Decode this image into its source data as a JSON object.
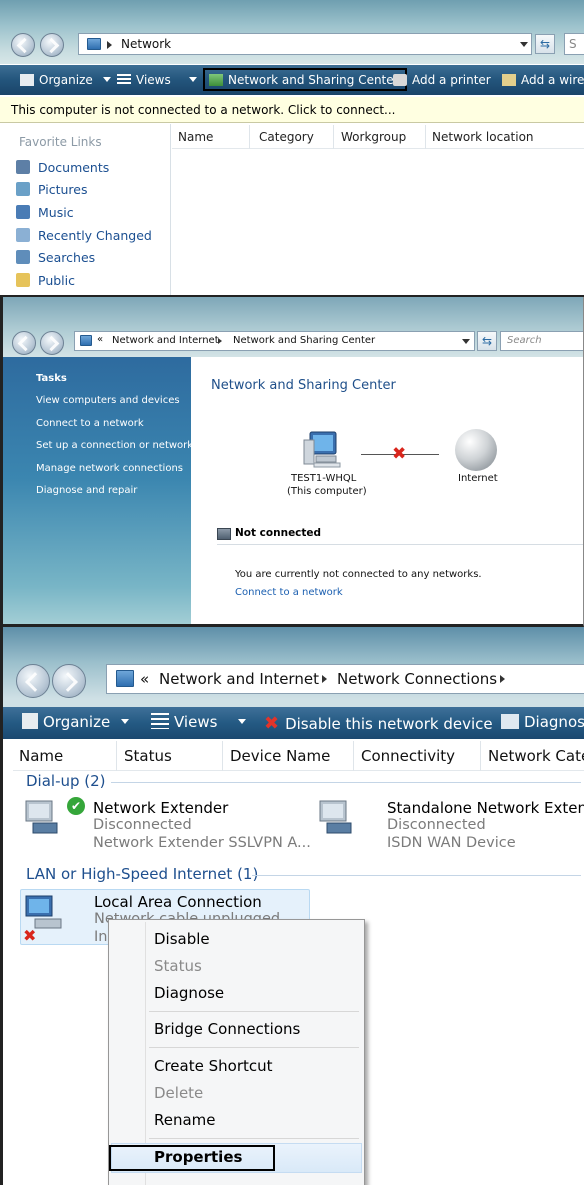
{
  "panel1": {
    "address": {
      "location": "Network",
      "search_hint": "S"
    },
    "toolbar": {
      "organize": "Organize",
      "views": "Views",
      "network_sharing_center": "Network and Sharing Center",
      "add_printer": "Add a printer",
      "add_wireless": "Add a wire"
    },
    "infobar": "This computer is not connected to a network. Click to connect...",
    "favorites": {
      "header": "Favorite Links",
      "items": [
        {
          "label": "Documents",
          "icon": "documents-icon"
        },
        {
          "label": "Pictures",
          "icon": "pictures-icon"
        },
        {
          "label": "Music",
          "icon": "music-icon"
        },
        {
          "label": "Recently Changed",
          "icon": "recent-icon"
        },
        {
          "label": "Searches",
          "icon": "searches-icon"
        },
        {
          "label": "Public",
          "icon": "public-folder-icon"
        }
      ]
    },
    "columns": [
      "Name",
      "Category",
      "Workgroup",
      "Network location"
    ]
  },
  "panel2": {
    "breadcrumb": {
      "prefix": "«",
      "part1": "Network and Internet",
      "part2": "Network and Sharing Center"
    },
    "search_placeholder": "Search",
    "tasks": {
      "header": "Tasks",
      "items": [
        "View computers and devices",
        "Connect to a network",
        "Set up a connection or network",
        "Manage network connections",
        "Diagnose and repair"
      ]
    },
    "title": "Network and Sharing Center",
    "computer_name": "TEST1-WHQL",
    "computer_sub": "(This computer)",
    "internet_label": "Internet",
    "status_heading": "Not connected",
    "status_message": "You are currently not connected to any networks.",
    "connect_link": "Connect to a network"
  },
  "panel3": {
    "breadcrumb": {
      "prefix": "«",
      "part1": "Network and Internet",
      "part2": "Network Connections"
    },
    "toolbar": {
      "organize": "Organize",
      "views": "Views",
      "disable_device": "Disable this network device",
      "diagnose": "Diagnos"
    },
    "columns": [
      "Name",
      "Status",
      "Device Name",
      "Connectivity",
      "Network Cate"
    ],
    "groups": {
      "dialup": "Dial-up (2)",
      "lan": "LAN or High-Speed Internet (1)"
    },
    "connections": {
      "extender": {
        "name": "Network Extender",
        "status": "Disconnected",
        "device": "Network Extender SSLVPN A..."
      },
      "standalone": {
        "name": "Standalone Network Extende",
        "status": "Disconnected",
        "device": "ISDN WAN Device"
      },
      "lan": {
        "name": "Local Area Connection",
        "status": "Network cable unplugged",
        "device": "In"
      }
    },
    "context_menu": {
      "disable": "Disable",
      "status": "Status",
      "diagnose": "Diagnose",
      "bridge": "Bridge Connections",
      "shortcut": "Create Shortcut",
      "delete": "Delete",
      "rename": "Rename",
      "properties": "Properties"
    }
  },
  "colors": {
    "toolbar_blue": "#23557c",
    "link_blue": "#1b4f91",
    "task_pane_blue": "#2e6b9f",
    "info_bar_yellow": "#ffffe1",
    "error_red": "#d9261c",
    "ok_green": "#35a63a"
  }
}
